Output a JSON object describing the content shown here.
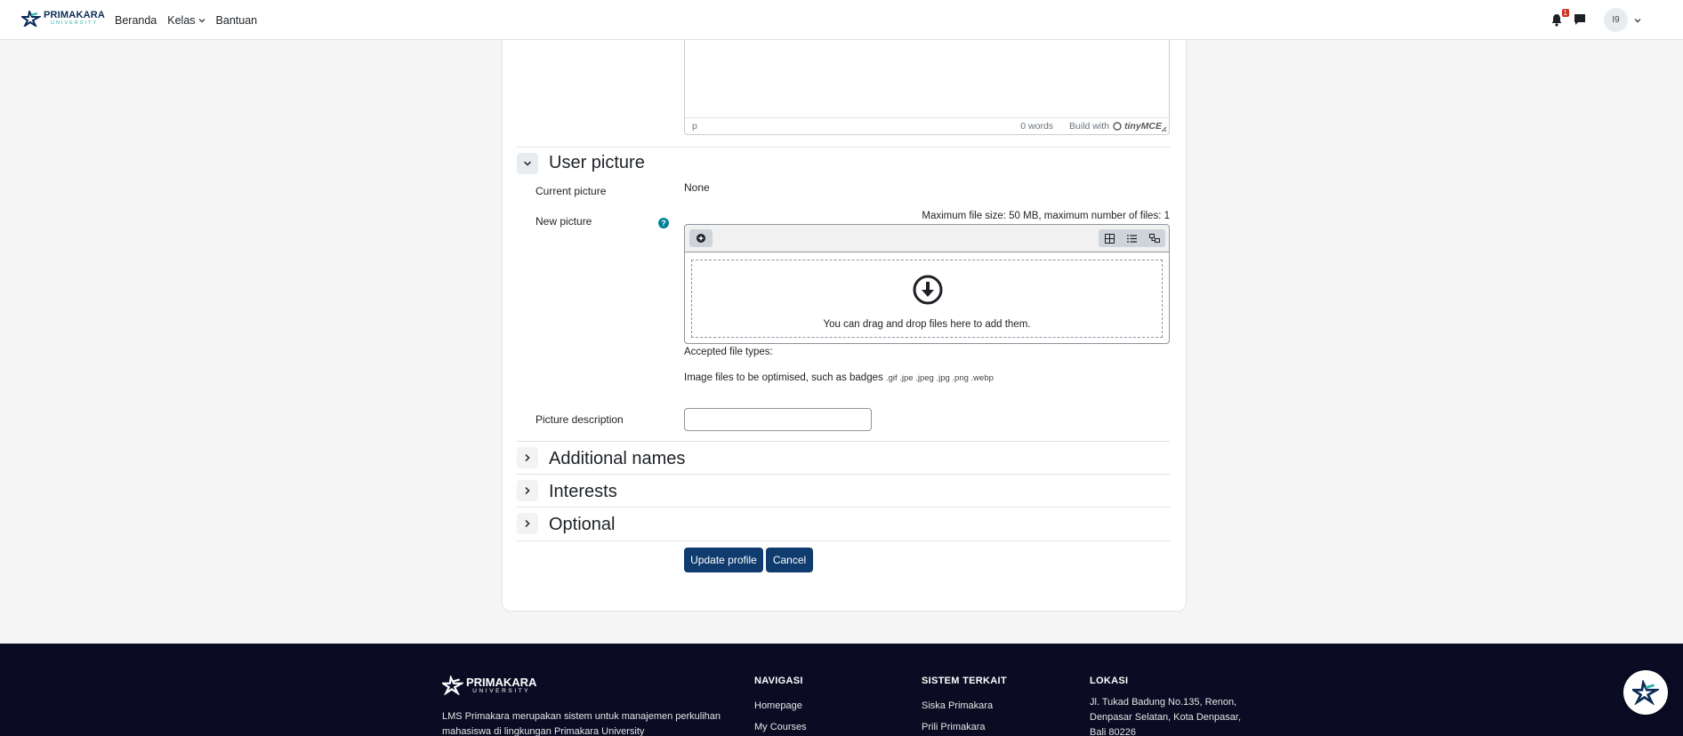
{
  "navbar": {
    "brand_name": "PRIMAKARA",
    "brand_sub": "UNIVERSITY",
    "links": [
      "Beranda",
      "Kelas",
      "Bantuan"
    ],
    "notification_count": "1",
    "avatar_initials": "I9"
  },
  "editor": {
    "path": "p",
    "words": "0 words",
    "build_with": "Build with",
    "tinymce": "tinyMCE"
  },
  "user_picture": {
    "title": "User picture",
    "current_label": "Current picture",
    "current_value": "None",
    "new_label": "New picture",
    "max_info": "Maximum file size: 50 MB, maximum number of files: 1",
    "drop_text": "You can drag and drop files here to add them.",
    "accepted_label": "Accepted file types:",
    "types_text": "Image files to be optimised, such as badges",
    "types_ext": ".gif .jpe .jpeg .jpg .png .webp",
    "description_label": "Picture description",
    "description_value": ""
  },
  "sections": {
    "additional_names": "Additional names",
    "interests": "Interests",
    "optional": "Optional"
  },
  "buttons": {
    "update": "Update profile",
    "cancel": "Cancel"
  },
  "footer": {
    "brand_name": "PRIMAKARA",
    "brand_sub": "UNIVERSITY",
    "description": "LMS Primakara merupakan sistem untuk manajemen perkulihan mahasiswa di lingkungan Primakara University",
    "nav_heading": "NAVIGASI",
    "nav_items": [
      "Homepage",
      "My Courses"
    ],
    "related_heading": "SISTEM TERKAIT",
    "related_items": [
      "Siska Primakara",
      "Prili Primakara"
    ],
    "location_heading": "LOKASI",
    "address": "Jl. Tukad Badung No.135, Renon, Denpasar Selatan, Kota Denpasar, Bali 80226"
  },
  "colors": {
    "primary_button": "#0f3b6e",
    "footer_bg": "#0b0b24",
    "help_icon": "#008196",
    "badge": "#ca3120"
  }
}
